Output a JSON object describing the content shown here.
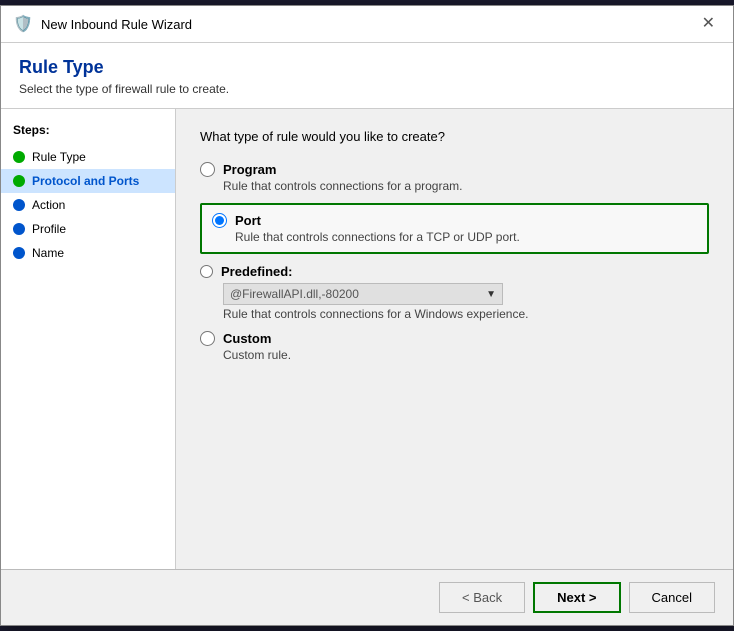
{
  "window": {
    "title": "New Inbound Rule Wizard",
    "icon": "🛡️",
    "close_label": "✕"
  },
  "header": {
    "title": "Rule Type",
    "subtitle": "Select the type of firewall rule to create."
  },
  "sidebar": {
    "steps_label": "Steps:",
    "items": [
      {
        "id": "rule-type",
        "label": "Rule Type",
        "dot": "green",
        "active": false
      },
      {
        "id": "protocol-and-ports",
        "label": "Protocol and Ports",
        "dot": "green",
        "active": true
      },
      {
        "id": "action",
        "label": "Action",
        "dot": "blue",
        "active": false
      },
      {
        "id": "profile",
        "label": "Profile",
        "dot": "blue",
        "active": false
      },
      {
        "id": "name",
        "label": "Name",
        "dot": "blue",
        "active": false
      }
    ]
  },
  "main": {
    "question": "What type of rule would you like to create?",
    "options": [
      {
        "id": "program",
        "label": "Program",
        "description": "Rule that controls connections for a program.",
        "selected": false,
        "highlighted": false
      },
      {
        "id": "port",
        "label": "Port",
        "description": "Rule that controls connections for a TCP or UDP port.",
        "selected": true,
        "highlighted": true
      },
      {
        "id": "predefined",
        "label": "Predefined:",
        "description": "Rule that controls connections for a Windows experience.",
        "selected": false,
        "highlighted": false,
        "has_dropdown": true,
        "dropdown_value": "@FirewallAPI.dll,-80200"
      },
      {
        "id": "custom",
        "label": "Custom",
        "description": "Custom rule.",
        "selected": false,
        "highlighted": false
      }
    ]
  },
  "footer": {
    "back_label": "< Back",
    "next_label": "Next >",
    "cancel_label": "Cancel"
  }
}
